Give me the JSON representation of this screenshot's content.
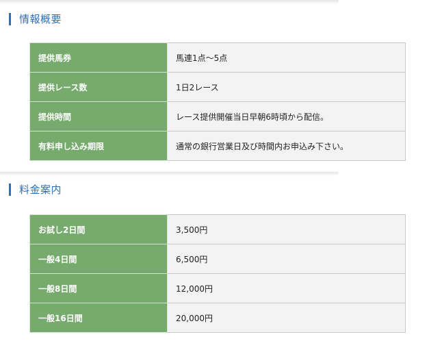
{
  "info_section": {
    "title": "情報概要",
    "rows": [
      {
        "label": "提供馬券",
        "value": "馬連1点〜5点"
      },
      {
        "label": "提供レース数",
        "value": "1日2レース"
      },
      {
        "label": "提供時間",
        "value": "レース提供開催当日早朝6時頃から配信。"
      },
      {
        "label": "有料申し込み期限",
        "value": "通常の銀行営業日及び時間内お申込み下さい。"
      }
    ]
  },
  "price_section": {
    "title": "料金案内",
    "rows": [
      {
        "label": "お試し2日間",
        "value": "3,500円"
      },
      {
        "label": "一般4日間",
        "value": "6,500円"
      },
      {
        "label": "一般8日間",
        "value": "12,000円"
      },
      {
        "label": "一般16日間",
        "value": "20,000円"
      }
    ]
  },
  "colors": {
    "heading_accent": "#2f6fb4",
    "label_background": "#76ab6d",
    "value_background": "#f3f3f3",
    "border": "#c8c8c8"
  }
}
